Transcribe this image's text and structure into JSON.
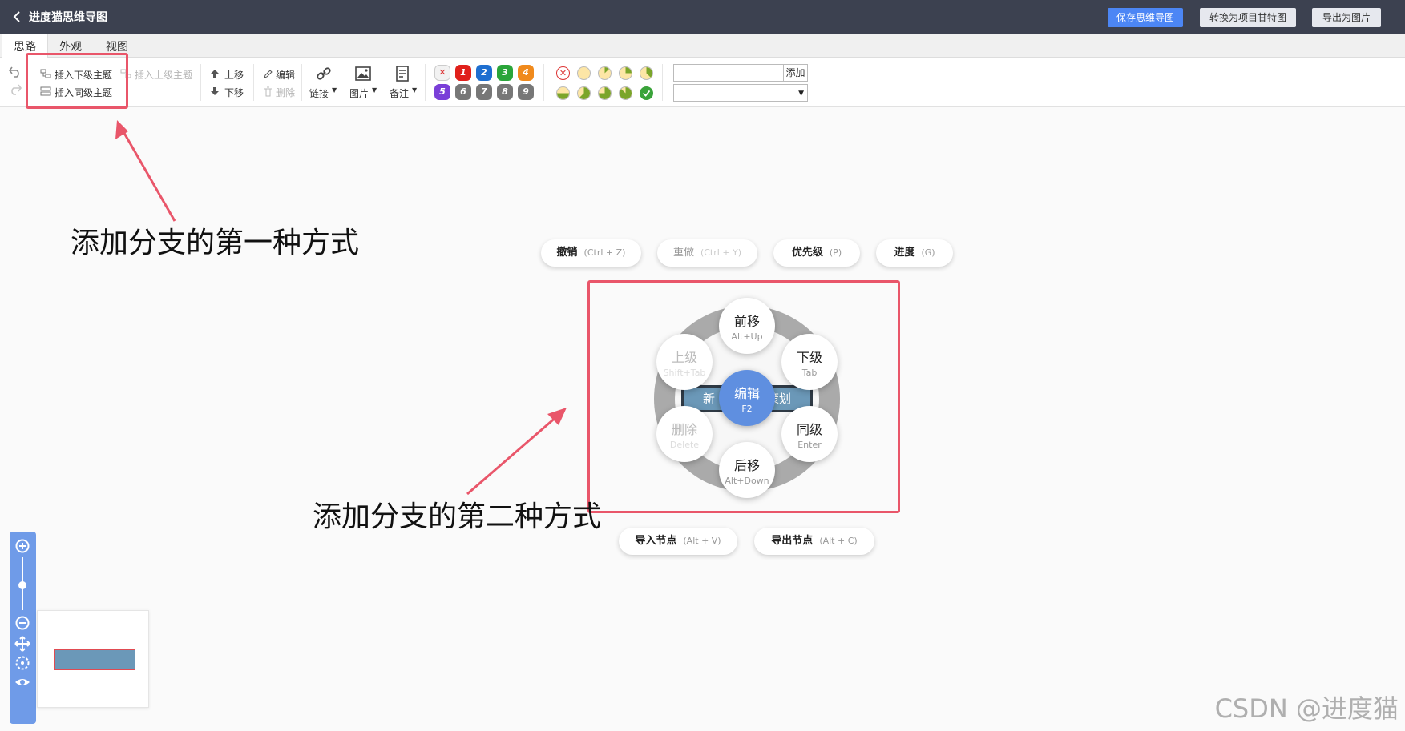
{
  "app": {
    "title": "进度猫思维导图",
    "buttons": {
      "save": "保存思维导图",
      "gantt": "转换为项目甘特图",
      "export": "导出为图片"
    }
  },
  "tabs": [
    "思路",
    "外观",
    "视图"
  ],
  "toolbar": {
    "insert_child": "插入下级主题",
    "insert_parent": "插入上级主题",
    "insert_sibling": "插入同级主题",
    "move_up": "上移",
    "move_down": "下移",
    "edit": "编辑",
    "delete": "删除",
    "link": "链接",
    "image": "图片",
    "note": "备注",
    "priorities": [
      "1",
      "2",
      "3",
      "4",
      "5",
      "6",
      "7",
      "8",
      "9"
    ],
    "add_button": "添加"
  },
  "annotations": {
    "first": "添加分支的第一种方式",
    "second": "添加分支的第二种方式"
  },
  "context_menu": {
    "undo": {
      "label": "撤销",
      "shortcut": "(Ctrl + Z)"
    },
    "redo": {
      "label": "重做",
      "shortcut": "(Ctrl + Y)"
    },
    "priority": {
      "label": "优先级",
      "shortcut": "(P)"
    },
    "progress": {
      "label": "进度",
      "shortcut": "(G)"
    },
    "import": {
      "label": "导入节点",
      "shortcut": "(Alt + V)"
    },
    "export": {
      "label": "导出节点",
      "shortcut": "(Alt + C)"
    },
    "forward": {
      "label": "前移",
      "shortcut": "Alt+Up"
    },
    "child": {
      "label": "下级",
      "shortcut": "Tab"
    },
    "sibling": {
      "label": "同级",
      "shortcut": "Enter"
    },
    "backward": {
      "label": "后移",
      "shortcut": "Alt+Down"
    },
    "remove": {
      "label": "删除",
      "shortcut": "Delete"
    },
    "parent": {
      "label": "上级",
      "shortcut": "Shift+Tab"
    },
    "edit": {
      "label": "编辑",
      "shortcut": "F2"
    }
  },
  "node": {
    "left": "新",
    "right": "策划"
  },
  "watermark": "CSDN @进度猫",
  "colors": {
    "titlebar": "#3c4150",
    "primary": "#4c86f5",
    "annotation": "#e9566a",
    "node": "#6b98b8",
    "edit_bubble": "#5f8fe0"
  }
}
